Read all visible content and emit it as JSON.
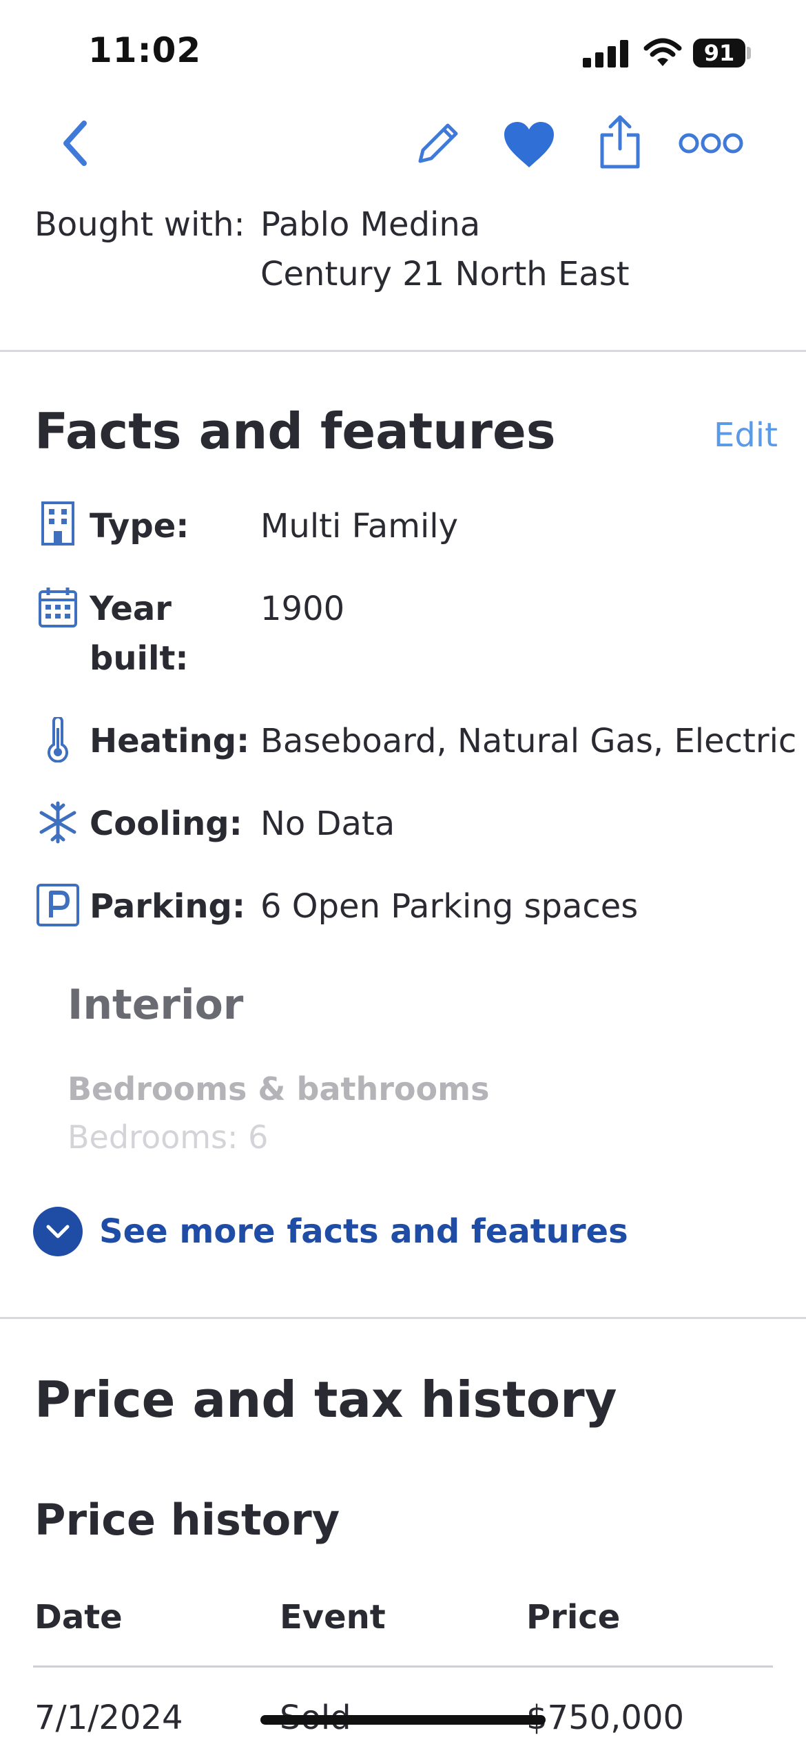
{
  "status_bar": {
    "time": "11:02",
    "battery": "91"
  },
  "toolbar": {
    "back_icon": "chevron-left-icon",
    "edit_icon": "pencil-icon",
    "favorite_icon": "heart-icon",
    "share_icon": "share-icon",
    "more_icon": "more-icon",
    "accent": "#3f7ad8"
  },
  "bought_with": {
    "label": "Bought with:",
    "agent": "Pablo Medina",
    "office": "Century 21 North East"
  },
  "facts": {
    "title": "Facts and features",
    "edit_label": "Edit",
    "items": [
      {
        "icon": "building-icon",
        "label": "Type:",
        "value": "Multi Family"
      },
      {
        "icon": "calendar-icon",
        "label_line1": "Year",
        "label_line2": "built:",
        "value": "1900"
      },
      {
        "icon": "thermometer-icon",
        "label": "Heating:",
        "value": "Baseboard, Natural Gas, Electric"
      },
      {
        "icon": "snowflake-icon",
        "label": "Cooling:",
        "value": "No Data"
      },
      {
        "icon": "parking-icon",
        "label": "Parking:",
        "value": "6 Open Parking spaces"
      }
    ],
    "interior_title": "Interior",
    "bedrooms_bathrooms": "Bedrooms & bathrooms",
    "bedrooms_line": "Bedrooms: 6",
    "see_more": "See more facts and features"
  },
  "price_tax": {
    "title": "Price and tax history",
    "price_history_title": "Price history",
    "columns": [
      "Date",
      "Event",
      "Price"
    ],
    "rows": [
      {
        "date": "7/1/2024",
        "event": "Sold",
        "price": "$750,000"
      }
    ]
  }
}
